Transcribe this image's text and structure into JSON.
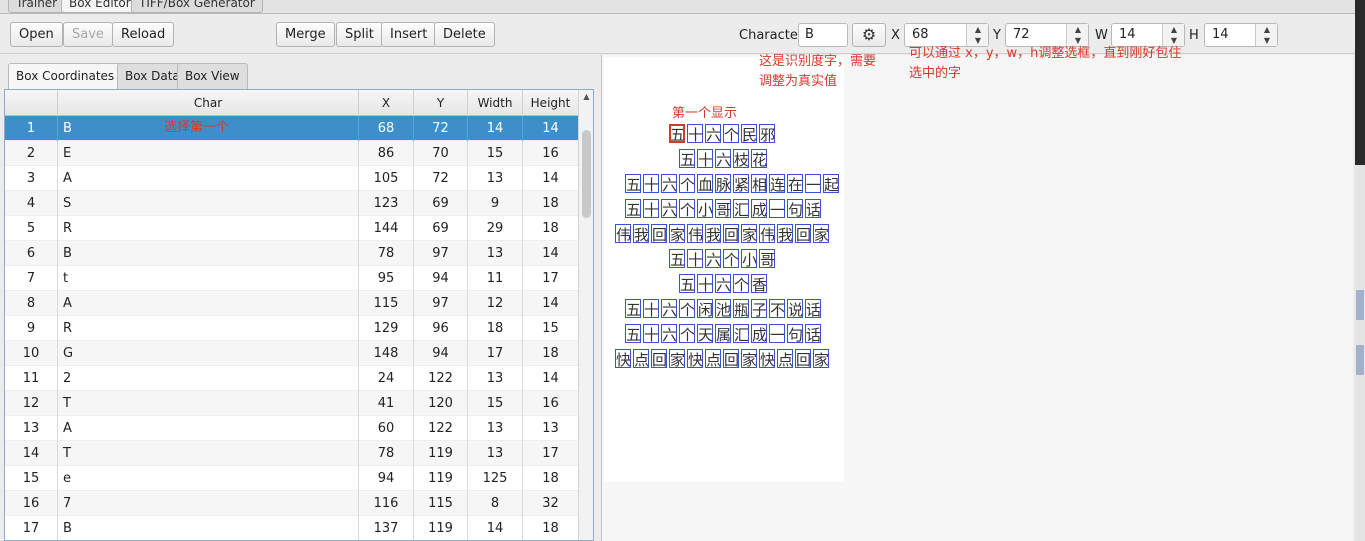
{
  "top_tabs": [
    "Trainer",
    "Box Editor",
    "TIFF/Box Generator"
  ],
  "toolbar": {
    "open": "Open",
    "save": "Save",
    "reload": "Reload",
    "merge": "Merge",
    "split": "Split",
    "insert": "Insert",
    "delete": "Delete",
    "character_label": "Character",
    "character_value": "B",
    "gear_icon": "gear-icon",
    "x_label": "X",
    "x_value": "68",
    "y_label": "Y",
    "y_value": "72",
    "w_label": "W",
    "w_value": "14",
    "h_label": "H",
    "h_value": "14"
  },
  "annotations": {
    "char_note_line1": "这是识别度字，需要",
    "char_note_line2": "调整为真实值",
    "xywh_note_line1": "可以通过 x，y，w，h调整选框，直到刚好包住",
    "xywh_note_line2": "选中的字",
    "select_first": "选择第一个",
    "first_shown": "第一个显示"
  },
  "sub_tabs": [
    "Box Coordinates",
    "Box Data",
    "Box View"
  ],
  "table": {
    "headers": [
      "",
      "Char",
      "X",
      "Y",
      "Width",
      "Height"
    ],
    "rows": [
      [
        "1",
        "B",
        "68",
        "72",
        "14",
        "14"
      ],
      [
        "2",
        "E",
        "86",
        "70",
        "15",
        "16"
      ],
      [
        "3",
        "A",
        "105",
        "72",
        "13",
        "14"
      ],
      [
        "4",
        "S",
        "123",
        "69",
        "9",
        "18"
      ],
      [
        "5",
        "R",
        "144",
        "69",
        "29",
        "18"
      ],
      [
        "6",
        "B",
        "78",
        "97",
        "13",
        "14"
      ],
      [
        "7",
        "t",
        "95",
        "94",
        "11",
        "17"
      ],
      [
        "8",
        "A",
        "115",
        "97",
        "12",
        "14"
      ],
      [
        "9",
        "R",
        "129",
        "96",
        "18",
        "15"
      ],
      [
        "10",
        "G",
        "148",
        "94",
        "17",
        "18"
      ],
      [
        "11",
        "2",
        "24",
        "122",
        "13",
        "14"
      ],
      [
        "12",
        "T",
        "41",
        "120",
        "15",
        "16"
      ],
      [
        "13",
        "A",
        "60",
        "122",
        "13",
        "13"
      ],
      [
        "14",
        "T",
        "78",
        "119",
        "13",
        "17"
      ],
      [
        "15",
        "e",
        "94",
        "119",
        "125",
        "18"
      ],
      [
        "16",
        "7",
        "116",
        "115",
        "8",
        "32"
      ],
      [
        "17",
        "B",
        "137",
        "119",
        "14",
        "18"
      ]
    ]
  },
  "image_lines": [
    "五十六个民邪",
    "五十六枝花",
    "五十六个血脉紧相连在一起",
    "五十六个小哥汇成一句话",
    "伟我回家伟我回家伟我回家",
    "五十六个小哥",
    "五十六个香",
    "五十六个闲池瓶子不说话",
    "五十六个天属汇成一句话",
    "快点回家快点回家快点回家"
  ]
}
